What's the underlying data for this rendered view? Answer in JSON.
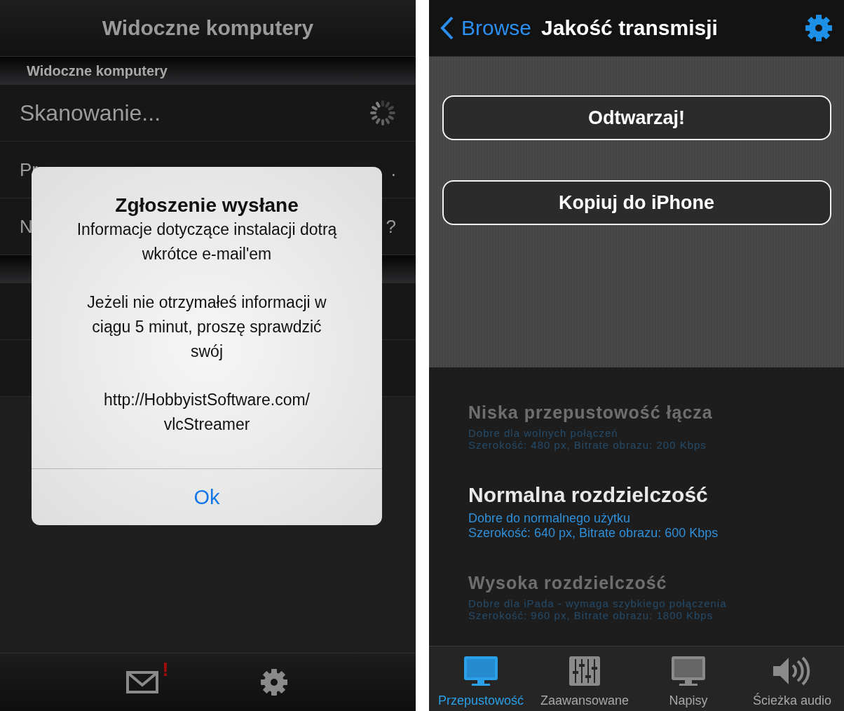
{
  "left_screen": {
    "nav_title": "Widoczne komputery",
    "sections": [
      {
        "header": "Widoczne komputery",
        "rows": [
          {
            "kind": "scanning",
            "text": "Skanowanie..."
          },
          {
            "kind": "partial",
            "text": "Pr",
            "trailing": "."
          },
          {
            "kind": "partial",
            "text": "N",
            "trailing": "?"
          }
        ]
      },
      {
        "rows": [
          {
            "kind": "empty"
          },
          {
            "kind": "empty"
          }
        ]
      }
    ],
    "dialog": {
      "title": "Zgłoszenie wysłane",
      "paragraphs": [
        "Informacje dotyczące instalacji dotrą\nwkrótce e-mail'em",
        "Jeżeli nie otrzymałeś informacji w\nciągu 5 minut, proszę sprawdzić\nswój",
        "http://HobbyistSoftware.com/\nvlcStreamer"
      ],
      "button": "Ok"
    },
    "toolbar": [
      {
        "kind": "mail",
        "alert": "!"
      },
      {
        "kind": "settings"
      }
    ]
  },
  "right_screen": {
    "back_label": "Browse",
    "nav_title": "Jakość transmisji",
    "buttons": [
      "Odtwarzaj!",
      "Kopiuj do iPhone"
    ],
    "quality_options": [
      {
        "title": "Niska przepustowość łącza",
        "description": "Dobre dla wolnych połączeń",
        "details": "Szerokość: 480 px, Bitrate obrazu: 200 Kbps",
        "selected": false
      },
      {
        "title": "Normalna rozdzielczość",
        "description": "Dobre do normalnego użytku",
        "details": "Szerokość: 640 px, Bitrate obrazu: 600 Kbps",
        "selected": true
      },
      {
        "title": "Wysoka rozdzielczość",
        "description": "Dobre dla iPada - wymaga szybkiego połączenia",
        "details": "Szerokość: 960 px, Bitrate obrazu: 1800 Kbps",
        "selected": false
      }
    ],
    "tabs": [
      {
        "kind": "monitor",
        "label": "Przepustowość",
        "selected": true
      },
      {
        "kind": "sliders",
        "label": "Zaawansowane",
        "selected": false
      },
      {
        "kind": "screen",
        "label": "Napisy",
        "selected": false
      },
      {
        "kind": "speaker",
        "label": "Ścieżka audio",
        "selected": false
      }
    ]
  }
}
